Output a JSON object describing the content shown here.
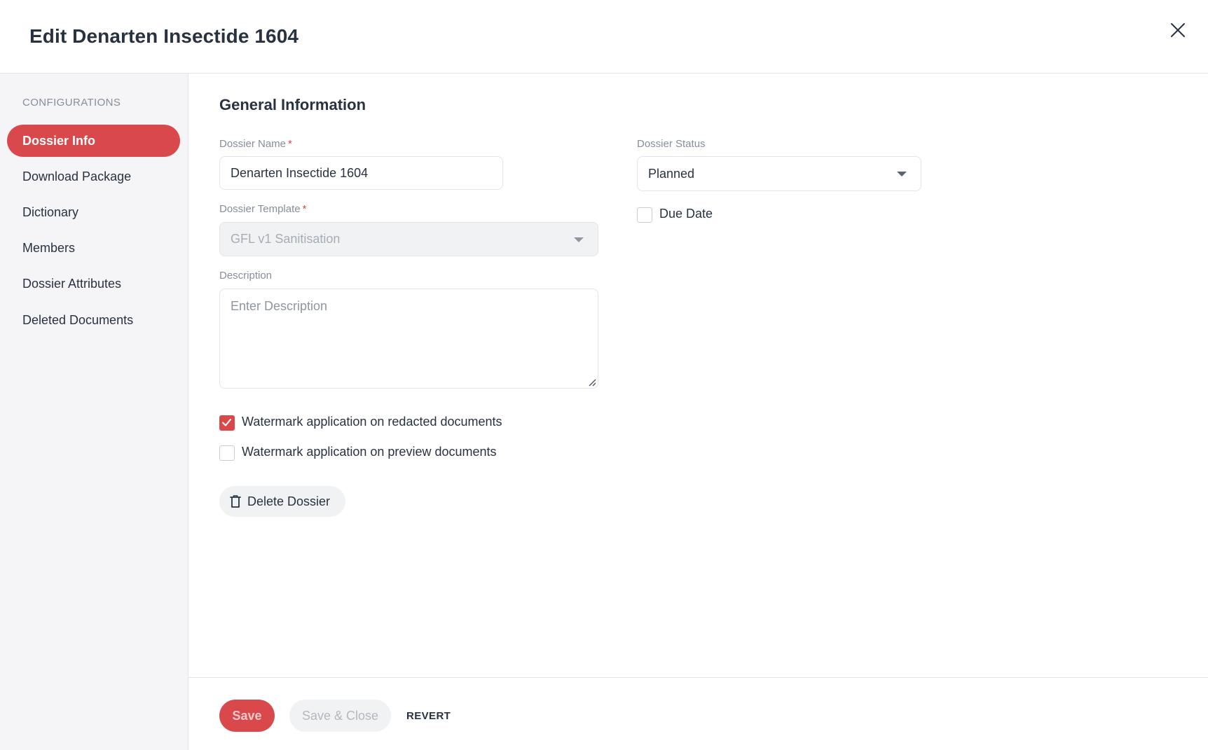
{
  "dialog": {
    "title": "Edit Denarten Insectide 1604"
  },
  "sidebar": {
    "heading": "CONFIGURATIONS",
    "items": [
      {
        "label": "Dossier Info",
        "active": true
      },
      {
        "label": "Download Package",
        "active": false
      },
      {
        "label": "Dictionary",
        "active": false
      },
      {
        "label": "Members",
        "active": false
      },
      {
        "label": "Dossier Attributes",
        "active": false
      },
      {
        "label": "Deleted Documents",
        "active": false
      }
    ]
  },
  "form": {
    "section_title": "General Information",
    "dossier_name": {
      "label": "Dossier Name",
      "required_mark": "*",
      "value": "Denarten Insectide 1604"
    },
    "dossier_template": {
      "label": "Dossier Template",
      "required_mark": "*",
      "value": "GFL v1 Sanitisation"
    },
    "description": {
      "label": "Description",
      "placeholder": "Enter Description"
    },
    "dossier_status": {
      "label": "Dossier Status",
      "value": "Planned"
    },
    "due_date": {
      "label": "Due Date",
      "checked": false
    },
    "watermark_redacted": {
      "label": "Watermark application on redacted documents",
      "checked": true
    },
    "watermark_preview": {
      "label": "Watermark application on preview documents",
      "checked": false
    },
    "delete_label": "Delete Dossier"
  },
  "footer": {
    "save_label": "Save",
    "save_close_label": "Save & Close",
    "revert_label": "REVERT"
  },
  "colors": {
    "accent": "#d9494c",
    "text": "#283241",
    "muted": "#868e9b",
    "sidebar_bg": "#f5f5f7",
    "border": "#e2e4e9"
  },
  "icons": {
    "close": "close-icon",
    "caret": "caret-down-icon",
    "delete": "trash-icon",
    "check": "checkmark-icon"
  }
}
